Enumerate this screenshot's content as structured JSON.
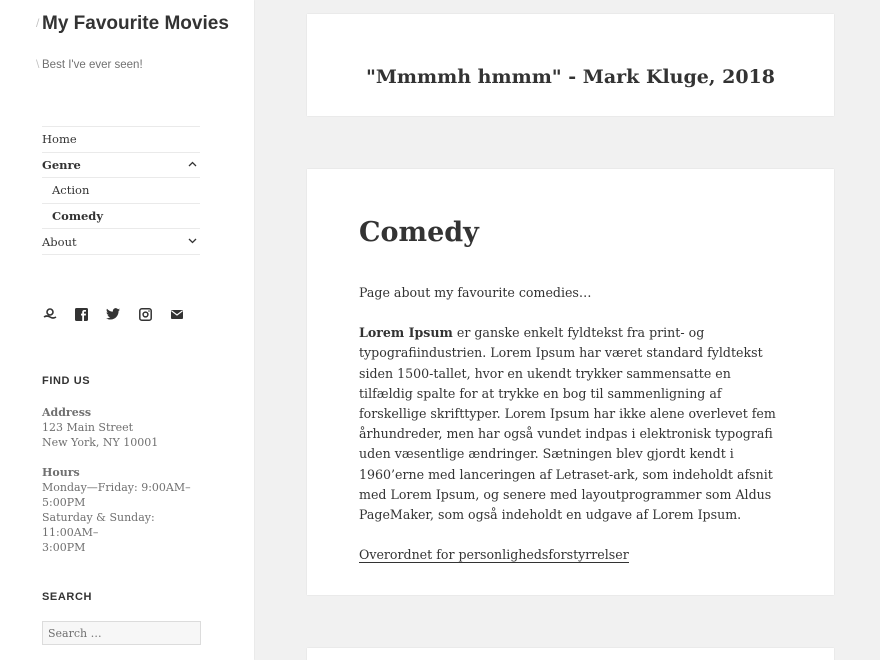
{
  "site": {
    "title": "My Favourite Movies",
    "description": "Best I've ever seen!"
  },
  "nav": {
    "items": [
      {
        "label": "Home"
      },
      {
        "label": "Genre",
        "toggle": "ˆ"
      },
      {
        "label": "Action"
      },
      {
        "label": "Comedy"
      },
      {
        "label": "About",
        "toggle": "ˇ"
      }
    ]
  },
  "social": {
    "icons": [
      "wordpress-icon",
      "facebook-icon",
      "twitter-icon",
      "instagram-icon",
      "email-icon"
    ]
  },
  "find_us": {
    "title": "FIND US",
    "address_label": "Address",
    "address_line1": "123 Main Street",
    "address_line2": "New York, NY 10001",
    "hours_label": "Hours",
    "hours_line1": "Monday—Friday: 9:00AM–",
    "hours_line2": "5:00PM",
    "hours_line3": "Saturday & Sunday: 11:00AM–",
    "hours_line4": "3:00PM"
  },
  "search": {
    "title": "SEARCH",
    "placeholder": "Search …"
  },
  "quote_card": {
    "text": "\"Mmmmh hmmm\" - Mark Kluge, 2018"
  },
  "page": {
    "title": "Comedy",
    "intro": "Page about my favourite comedies…",
    "lorem_bold": "Lorem Ipsum",
    "lorem_text": " er ganske enkelt fyldtekst fra print- og typografiindustrien. Lorem Ipsum har været standard fyldtekst siden 1500-tallet, hvor en ukendt trykker sammensatte en tilfældig spalte for at trykke en bog til sammenligning af forskellige skrifttyper. Lorem Ipsum har ikke alene overlevet fem århundreder, men har også vundet indpas i elektronisk typografi uden væsentlige ændringer. Sætningen blev gjordt kendt i 1960’erne med lanceringen af Letraset-ark, som indeholdt afsnit med Lorem Ipsum, og senere med layoutprogrammer som Aldus PageMaker, som også indeholdt en udgave af Lorem Ipsum.",
    "link": "Overordnet for personlighedsforstyrrelser"
  }
}
